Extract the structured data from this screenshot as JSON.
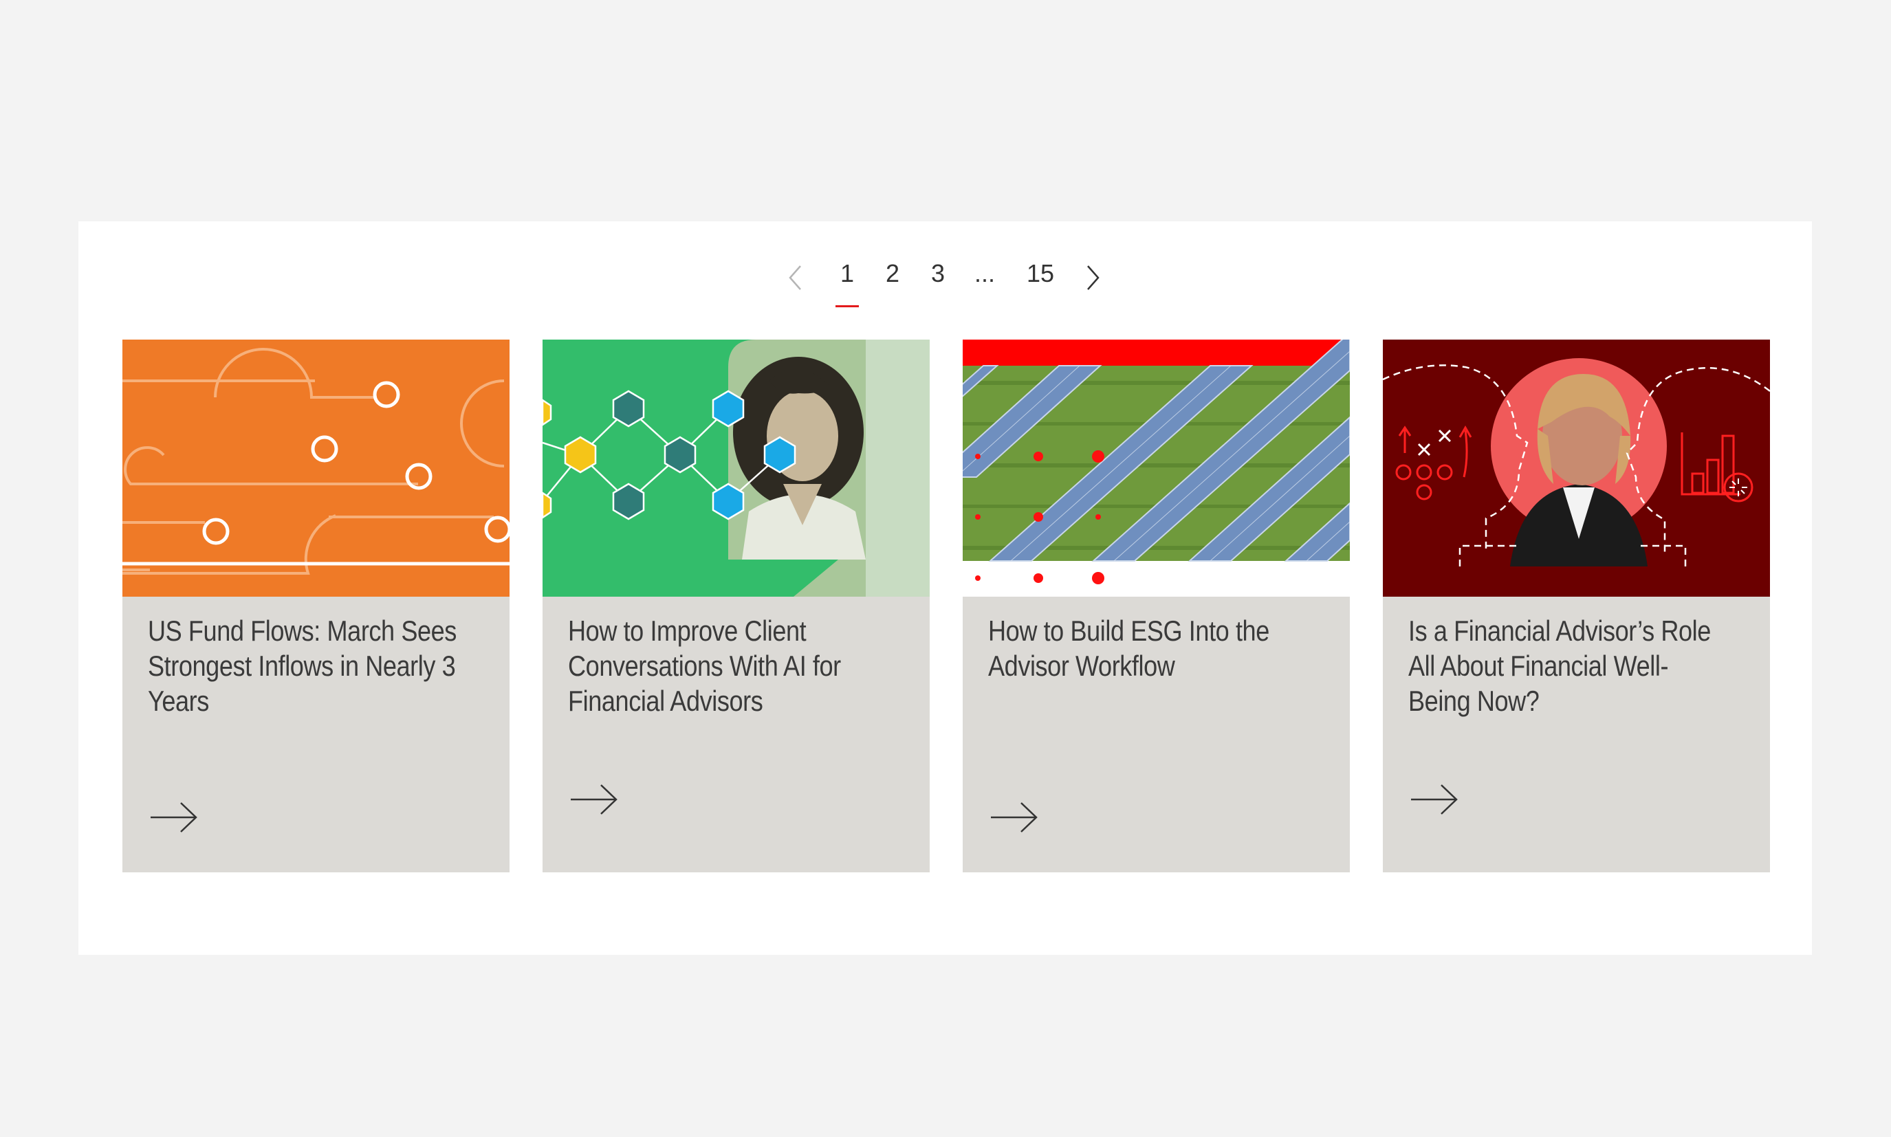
{
  "pagination": {
    "prev_icon": "chevron-left-icon",
    "next_icon": "chevron-right-icon",
    "pages": [
      "1",
      "2",
      "3",
      "...",
      "15"
    ],
    "current": "1",
    "accent_color": "#e31a1c"
  },
  "cards": [
    {
      "title": "US Fund Flows: March Sees Strongest Inflows in Nearly 3 Years",
      "image": "orange-line-pattern",
      "background_color": "#ef7a27",
      "arrow_icon": "arrow-right-icon"
    },
    {
      "title": "How to Improve Client Conversations With AI for Financial Advisors",
      "image": "hexagon-network-with-smiling-woman",
      "background_color": "#33bd6b",
      "arrow_icon": "arrow-right-icon"
    },
    {
      "title": "How to Build ESG Into the Advisor Workflow",
      "image": "solar-panels-aerial",
      "background_color": "#6a8f3a",
      "arrow_icon": "arrow-right-icon"
    },
    {
      "title": "Is a Financial Advisor’s Role All About Financial Well-Being Now?",
      "image": "advisor-woman-red-illustration",
      "background_color": "#6b0000",
      "arrow_icon": "arrow-right-icon"
    }
  ]
}
